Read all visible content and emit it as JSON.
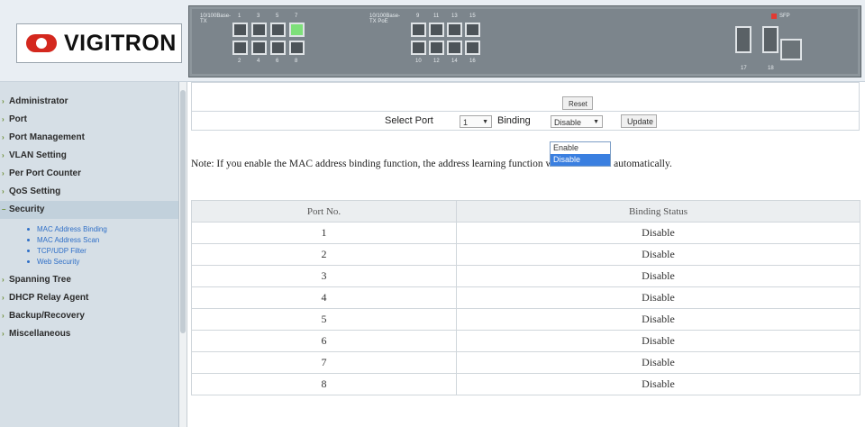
{
  "brand": {
    "logo_text": "VIGITRON"
  },
  "panel": {
    "labels": [
      "10/100Base-TX",
      "10/100Base-TX PoE"
    ],
    "port_numbers_top": [
      "1",
      "3",
      "5",
      "7",
      "9",
      "11",
      "13",
      "15"
    ],
    "port_numbers_bottom": [
      "2",
      "4",
      "6",
      "8",
      "10",
      "12",
      "14",
      "16"
    ],
    "sfp_labels": [
      "17",
      "18"
    ],
    "right_label": "SFP"
  },
  "sidebar": {
    "items": [
      {
        "label": "Administrator"
      },
      {
        "label": "Port"
      },
      {
        "label": "Port Management"
      },
      {
        "label": "VLAN Setting"
      },
      {
        "label": "Per Port Counter"
      },
      {
        "label": "QoS Setting"
      },
      {
        "label": "Security"
      },
      {
        "label": "Spanning Tree"
      },
      {
        "label": "DHCP Relay Agent"
      },
      {
        "label": "Backup/Recovery"
      },
      {
        "label": "Miscellaneous"
      }
    ],
    "security_sub": [
      {
        "label": "MAC Address Binding"
      },
      {
        "label": "MAC Address Scan"
      },
      {
        "label": "TCP/UDP Filter"
      },
      {
        "label": "Web Security"
      }
    ]
  },
  "form": {
    "reset_label": "Reset",
    "select_port_label": "Select Port",
    "port_value": "1",
    "binding_label": "Binding",
    "binding_value": "Disable",
    "update_label": "Update",
    "binding_options": [
      "Enable",
      "Disable"
    ]
  },
  "note": "Note: If you enable the MAC address binding function, the address learning function will be disabled automatically.",
  "table": {
    "headers": [
      "Port No.",
      "Binding Status"
    ],
    "rows": [
      [
        "1",
        "Disable"
      ],
      [
        "2",
        "Disable"
      ],
      [
        "3",
        "Disable"
      ],
      [
        "4",
        "Disable"
      ],
      [
        "5",
        "Disable"
      ],
      [
        "6",
        "Disable"
      ],
      [
        "7",
        "Disable"
      ],
      [
        "8",
        "Disable"
      ]
    ]
  },
  "colors": {
    "panel": "#7c858c",
    "active_port": "#7ee07a",
    "selected_option": "#3a7fe0",
    "link": "#2f6fc7"
  }
}
